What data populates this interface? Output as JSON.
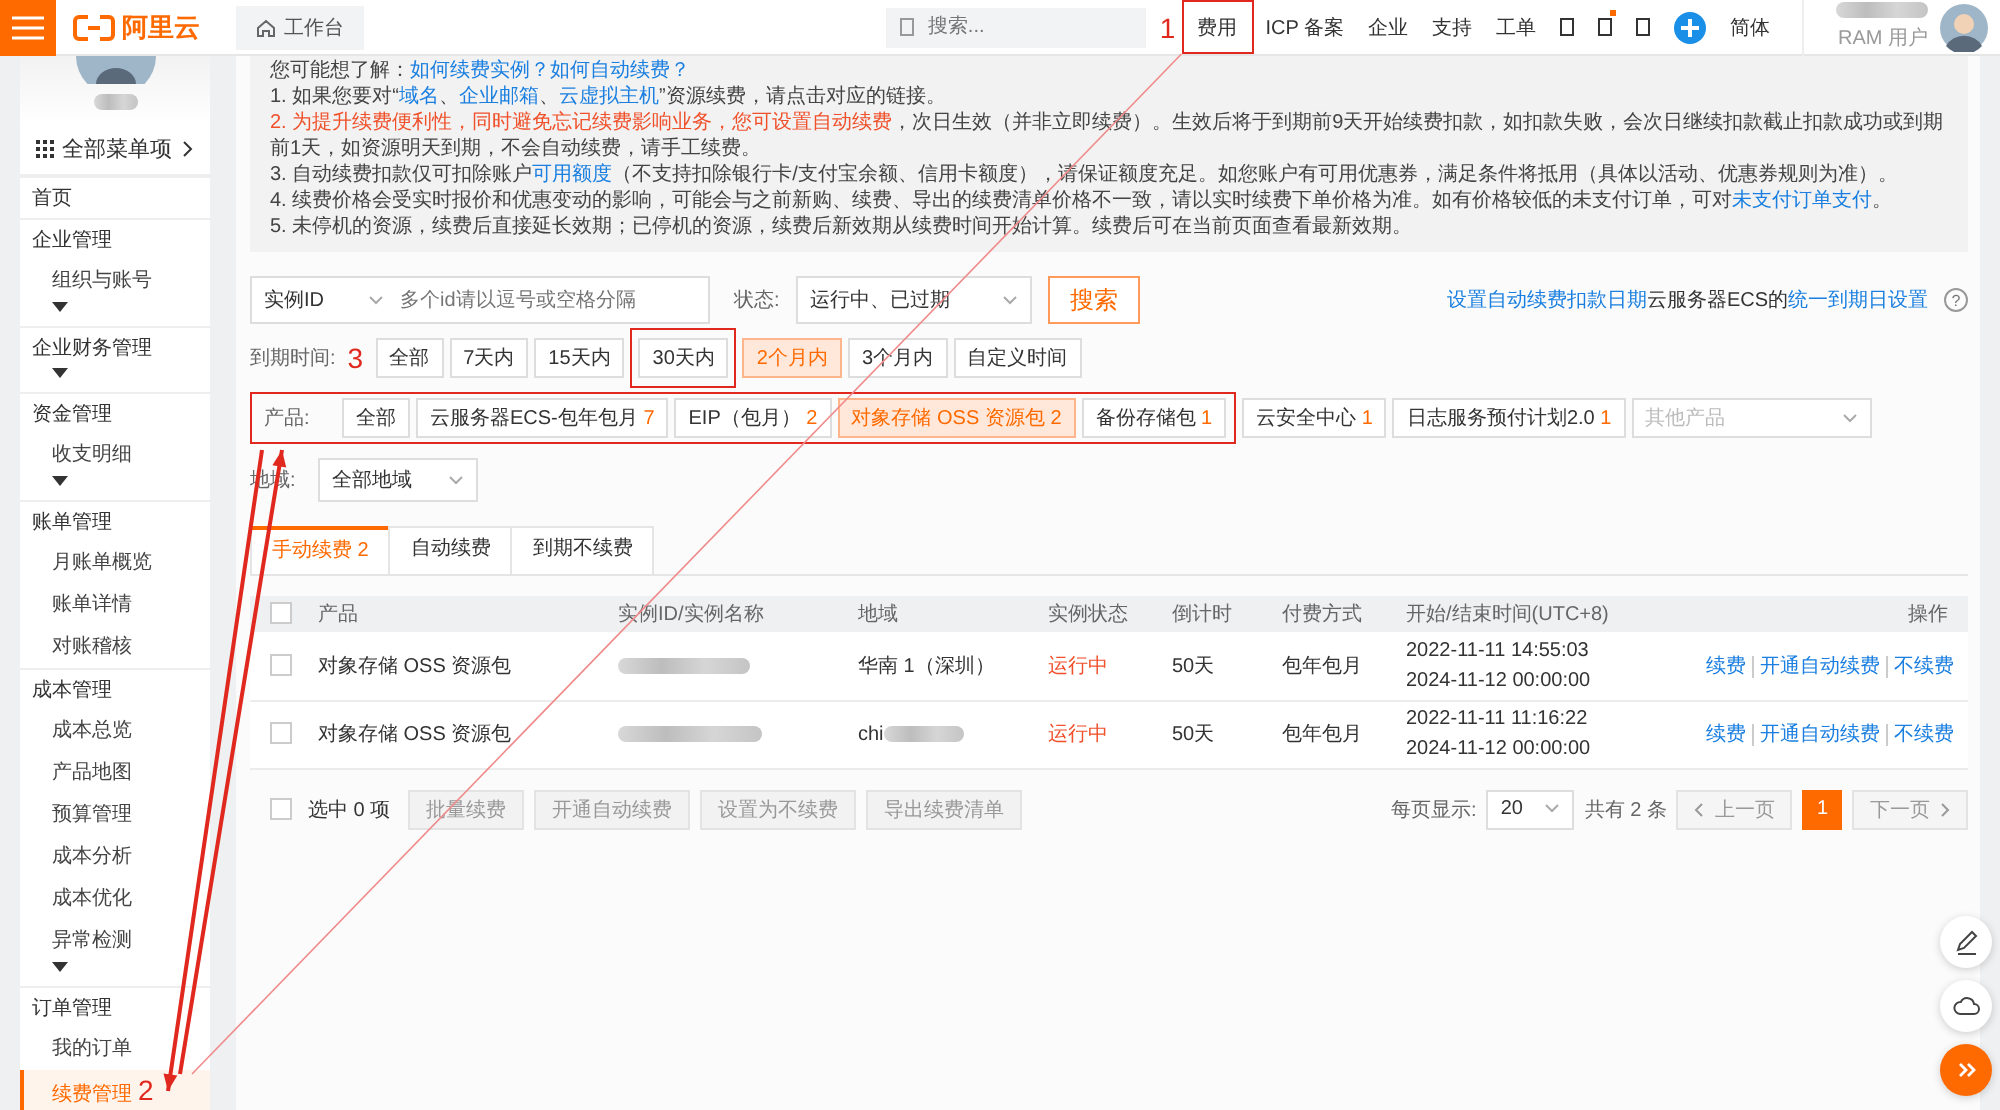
{
  "topbar": {
    "logo": "阿里云",
    "workbench": "工作台",
    "search_placeholder": "搜索...",
    "nav": [
      {
        "label": "费用",
        "highlighted": true,
        "annotation": "1"
      },
      {
        "label": "ICP 备案",
        "highlighted": false
      },
      {
        "label": "企业",
        "highlighted": false
      },
      {
        "label": "支持",
        "highlighted": false
      },
      {
        "label": "工单",
        "highlighted": false
      }
    ],
    "icons": [
      {
        "kind": "square",
        "dot": false
      },
      {
        "kind": "square",
        "dot": true
      },
      {
        "kind": "square",
        "dot": false
      },
      {
        "kind": "plus",
        "dot": false
      }
    ],
    "language": "简体",
    "user_role": "RAM 用户"
  },
  "sidebar": {
    "menu_all": "全部菜单项",
    "items": [
      {
        "kind": "link",
        "label": "首页",
        "selected": false
      },
      {
        "kind": "group",
        "label": "企业管理",
        "more": true,
        "children": [
          {
            "label": "组织与账号",
            "selected": false
          }
        ]
      },
      {
        "kind": "group",
        "label": "企业财务管理",
        "more": true
      },
      {
        "kind": "group",
        "label": "资金管理",
        "more": true,
        "children": [
          {
            "label": "收支明细",
            "selected": false
          }
        ]
      },
      {
        "kind": "group",
        "label": "账单管理",
        "more": false,
        "children": [
          {
            "label": "月账单概览",
            "selected": false
          },
          {
            "label": "账单详情",
            "selected": false
          },
          {
            "label": "对账稽核",
            "selected": false
          }
        ]
      },
      {
        "kind": "group",
        "label": "成本管理",
        "more": true,
        "children": [
          {
            "label": "成本总览",
            "selected": false
          },
          {
            "label": "产品地图",
            "selected": false
          },
          {
            "label": "预算管理",
            "selected": false
          },
          {
            "label": "成本分析",
            "selected": false
          },
          {
            "label": "成本优化",
            "selected": false
          },
          {
            "label": "异常检测",
            "selected": false
          }
        ]
      },
      {
        "kind": "group",
        "label": "订单管理",
        "more": false,
        "children": [
          {
            "label": "我的订单",
            "selected": false
          },
          {
            "label": "续费管理",
            "selected": true,
            "annotation": "2"
          }
        ]
      }
    ]
  },
  "notice": {
    "lines": [
      [
        {
          "kind": "text",
          "text": "您可能想了解："
        },
        {
          "kind": "link",
          "text": "如何续费实例？"
        },
        {
          "kind": "link",
          "text": "如何自动续费？"
        }
      ],
      [
        {
          "kind": "text",
          "text": "1. 如果您要对“"
        },
        {
          "kind": "link",
          "text": "域名"
        },
        {
          "kind": "text",
          "text": "、"
        },
        {
          "kind": "link",
          "text": "企业邮箱"
        },
        {
          "kind": "text",
          "text": "、"
        },
        {
          "kind": "link",
          "text": "云虚拟主机"
        },
        {
          "kind": "text",
          "text": "”资源续费，请点击对应的链接。"
        }
      ],
      [
        {
          "kind": "warn",
          "text": "2. 为提升续费便利性，同时避免忘记续费影响业务，您可设置自动续费"
        },
        {
          "kind": "text",
          "text": "，次日生效（并非立即续费）。生效后将于到期前9天开始续费扣款，如扣款失败，会次日继续扣款截止扣款成功或到期前1天，如资源明天到期，不会自动续费，请手工续费。"
        }
      ],
      [
        {
          "kind": "text",
          "text": "3. 自动续费扣款仅可扣除账户"
        },
        {
          "kind": "link",
          "text": "可用额度"
        },
        {
          "kind": "text",
          "text": "（不支持扣除银行卡/支付宝余额、信用卡额度），请保证额度充足。如您账户有可用优惠券，满足条件将抵用（具体以活动、优惠券规则为准）。"
        }
      ],
      [
        {
          "kind": "text",
          "text": "4. 续费价格会受实时报价和优惠变动的影响，可能会与之前新购、续费、导出的续费清单价格不一致，请以实时续费下单价格为准。如有价格较低的未支付订单，可对"
        },
        {
          "kind": "link",
          "text": "未支付订单支付"
        },
        {
          "kind": "text",
          "text": "。"
        }
      ],
      [
        {
          "kind": "text",
          "text": "5. 未停机的资源，续费后直接延长效期；已停机的资源，续费后新效期从续费时间开始计算。续费后可在当前页面查看最新效期。"
        }
      ]
    ]
  },
  "search": {
    "field": "实例ID",
    "placeholder": "多个id请以逗号或空格分隔",
    "status_label": "状态:",
    "status_value": "运行中、已过期",
    "button": "搜索",
    "right": [
      {
        "kind": "link",
        "text": "设置自动续费扣款日期"
      },
      {
        "kind": "text",
        "text": "云服务器ECS的"
      },
      {
        "kind": "link",
        "text": "统一到期日设置"
      }
    ],
    "help": "?"
  },
  "expiry": {
    "label": "到期时间:",
    "annotation": "3",
    "options": [
      {
        "label": "全部",
        "selected": false,
        "highlighted": false
      },
      {
        "label": "7天内",
        "selected": false,
        "highlighted": false
      },
      {
        "label": "15天内",
        "selected": false,
        "highlighted": false
      },
      {
        "label": "30天内",
        "selected": false,
        "highlighted": true
      },
      {
        "label": "2个月内",
        "selected": true,
        "highlighted": false
      },
      {
        "label": "3个月内",
        "selected": false,
        "highlighted": false
      },
      {
        "label": "自定义时间",
        "selected": false,
        "highlighted": false
      }
    ]
  },
  "products": {
    "label": "产品:",
    "other_placeholder": "其他产品",
    "boxed_options": [
      {
        "label": "全部",
        "selected": false
      },
      {
        "label": "云服务器ECS-包年包月",
        "count": "7",
        "selected": false
      },
      {
        "label": "EIP（包月）",
        "count": "2",
        "selected": false
      },
      {
        "label": "对象存储 OSS 资源包",
        "count": "2",
        "selected": true
      },
      {
        "label": "备份存储包",
        "count": "1",
        "selected": false
      }
    ],
    "options": [
      {
        "label": "云安全中心",
        "count": "1",
        "selected": false
      },
      {
        "label": "日志服务预付计划2.0",
        "count": "1",
        "selected": false
      }
    ]
  },
  "region": {
    "label": "地域:",
    "value": "全部地域"
  },
  "tabs": [
    {
      "label": "手动续费",
      "count": "2",
      "selected": true
    },
    {
      "label": "自动续费",
      "selected": false
    },
    {
      "label": "到期不续费",
      "selected": false
    }
  ],
  "table": {
    "all_checked": false,
    "columns": [
      "产品",
      "实例ID/实例名称",
      "地域",
      "实例状态",
      "倒计时",
      "付费方式",
      "开始/结束时间(UTC+8)",
      "操作"
    ],
    "rows": [
      {
        "checked": false,
        "product": "对象存储 OSS 资源包",
        "id_redacted": true,
        "region": "华南 1（深圳）",
        "region_redacted": false,
        "status": "运行中",
        "running": true,
        "countdown": "50天",
        "billing": "包年包月",
        "start": "2022-11-11 14:55:03",
        "end": "2024-11-12 00:00:00",
        "actions": [
          "续费",
          "开通自动续费",
          "不续费"
        ]
      },
      {
        "checked": false,
        "product": "对象存储 OSS 资源包",
        "id_redacted": true,
        "region": "chi",
        "region_redacted": true,
        "status": "运行中",
        "running": true,
        "countdown": "50天",
        "billing": "包年包月",
        "start": "2022-11-11 11:16:22",
        "end": "2024-11-12 00:00:00",
        "actions": [
          "续费",
          "开通自动续费",
          "不续费"
        ]
      }
    ]
  },
  "footer": {
    "checked": false,
    "selected_text": "选中 0 项",
    "buttons": [
      {
        "label": "批量续费",
        "disabled": true
      },
      {
        "label": "开通自动续费",
        "disabled": true
      },
      {
        "label": "设置为不续费",
        "disabled": true
      },
      {
        "label": "导出续费清单",
        "disabled": true
      }
    ],
    "page_size_label": "每页显示:",
    "page_size": "20",
    "total": "共有 2 条",
    "prev": "上一页",
    "next": "下一页",
    "pages": [
      {
        "label": "1",
        "selected": true
      }
    ]
  },
  "float_tools": [
    {
      "kind": "edit"
    },
    {
      "kind": "cloud"
    },
    {
      "kind": "expand"
    }
  ]
}
